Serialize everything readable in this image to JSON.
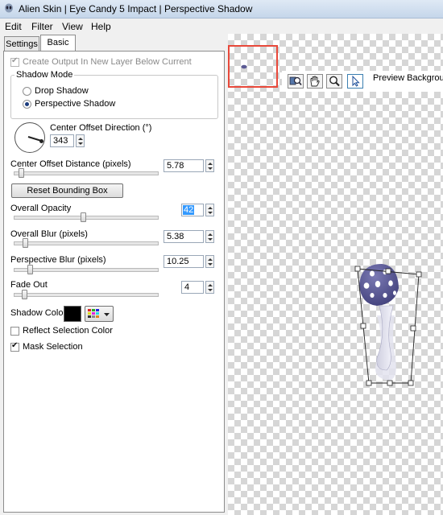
{
  "window": {
    "title": "Alien Skin | Eye Candy 5 Impact | Perspective Shadow"
  },
  "menu": {
    "items": [
      "Edit",
      "Filter",
      "View",
      "Help"
    ]
  },
  "tabs": {
    "settings": "Settings",
    "basic": "Basic"
  },
  "panel": {
    "create_output": {
      "label": "Create Output In New Layer Below Current",
      "checked": true,
      "enabled": false
    },
    "shadow_mode": {
      "group_label": "Shadow Mode",
      "drop_shadow": "Drop Shadow",
      "perspective_shadow": "Perspective Shadow",
      "selected": "Perspective Shadow"
    },
    "center_offset_direction": {
      "label": "Center Offset Direction (°)",
      "value": "343"
    },
    "center_offset_distance": {
      "label": "Center Offset Distance (pixels)",
      "value": "5.78"
    },
    "reset_button": "Reset Bounding Box",
    "overall_opacity": {
      "label": "Overall Opacity",
      "value": "42"
    },
    "overall_blur": {
      "label": "Overall Blur (pixels)",
      "value": "5.38"
    },
    "perspective_blur": {
      "label": "Perspective Blur (pixels)",
      "value": "10.25"
    },
    "fade_out": {
      "label": "Fade Out",
      "value": "4"
    },
    "shadow_color": {
      "label": "Shadow Color",
      "color": "#000000"
    },
    "reflect_selection_color": {
      "label": "Reflect Selection Color",
      "checked": false
    },
    "mask_selection": {
      "label": "Mask Selection",
      "checked": true
    }
  },
  "preview": {
    "background_label": "Preview Background",
    "tools": [
      "zoom-compare-icon",
      "hand-icon",
      "zoom-icon",
      "pointer-icon"
    ],
    "active_tool": "pointer-icon",
    "navigator_frame_color": "#e8483a"
  },
  "colors": {
    "accent_selection": "#3399ff",
    "mushroom_cap": "#5b5a94",
    "checker_dark": "#d6d6d6"
  }
}
